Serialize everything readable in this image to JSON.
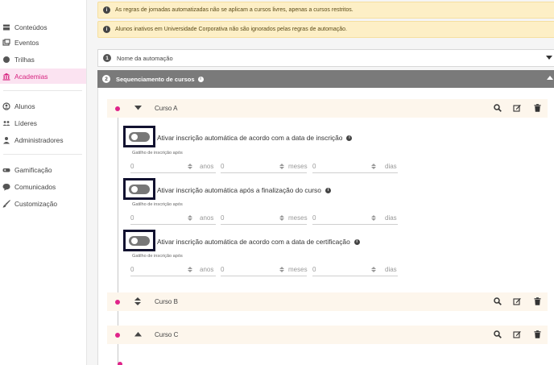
{
  "sidebar": {
    "items": [
      {
        "label": "Conteúdos",
        "icon": "layers-icon",
        "active": false
      },
      {
        "label": "Eventos",
        "icon": "calendar-icon",
        "active": false
      },
      {
        "label": "Trilhas",
        "icon": "circle-icon",
        "active": false
      },
      {
        "label": "Academias",
        "icon": "bank-icon",
        "active": true
      },
      {
        "label": "Alunos",
        "icon": "person-circle-icon",
        "active": false
      },
      {
        "label": "Líderes",
        "icon": "group-icon",
        "active": false
      },
      {
        "label": "Administradores",
        "icon": "user-admin-icon",
        "active": false
      },
      {
        "label": "Gamificação",
        "icon": "gamepad-icon",
        "active": false
      },
      {
        "label": "Comunicados",
        "icon": "chat-icon",
        "active": false
      },
      {
        "label": "Customização",
        "icon": "brush-icon",
        "active": false
      }
    ]
  },
  "notices": [
    "As regras de jornadas automatizadas não se aplicam a cursos livres, apenas a cursos restritos.",
    "Alunos inativos em Universidade Corporativa não são ignorados pelas regras de automação."
  ],
  "sections": {
    "automation_name": {
      "number": "1",
      "label": "Nome da automação"
    },
    "sequencing": {
      "number": "2",
      "label": "Sequenciamento de cursos"
    }
  },
  "courses": [
    {
      "name": "Curso A"
    },
    {
      "name": "Curso B"
    },
    {
      "name": "Curso C"
    }
  ],
  "options": [
    {
      "label": "Ativar inscrição automática de acordo com a data de inscrição",
      "trigger_label": "Gatilho de inscrição após",
      "fields": [
        {
          "value": "0",
          "unit": "anos"
        },
        {
          "value": "0",
          "unit": "meses"
        },
        {
          "value": "0",
          "unit": "dias"
        }
      ]
    },
    {
      "label": "Ativar inscrição automática após a finalização do curso",
      "trigger_label": "Gatilho de inscrição após",
      "fields": [
        {
          "value": "0",
          "unit": "anos"
        },
        {
          "value": "0",
          "unit": "meses"
        },
        {
          "value": "0",
          "unit": "dias"
        }
      ]
    },
    {
      "label": "Ativar inscrição automática de acordo com a data de certificação",
      "trigger_label": "Gatilho de inscrição após",
      "fields": [
        {
          "value": "0",
          "unit": "anos"
        },
        {
          "value": "0",
          "unit": "meses"
        },
        {
          "value": "0",
          "unit": "dias"
        }
      ]
    }
  ],
  "colors": {
    "accent": "#d6237f",
    "notice_bg": "#fdefc6",
    "section_dark": "#7a7a7a",
    "course_row_bg": "#fdf6ec"
  }
}
